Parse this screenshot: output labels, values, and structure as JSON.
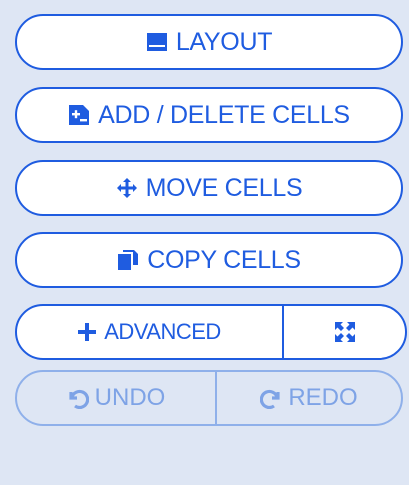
{
  "colors": {
    "background": "#dee6f4",
    "accent": "#1f5ce0",
    "disabled": "#7ea3e6",
    "button_bg": "#ffffff"
  },
  "buttons": {
    "layout": {
      "label": "LAYOUT",
      "icon": "window-icon"
    },
    "add_delete": {
      "label": "ADD / DELETE CELLS",
      "icon": "plus-square-icon"
    },
    "move": {
      "label": "MOVE CELLS",
      "icon": "move-arrows-icon"
    },
    "copy": {
      "label": "COPY CELLS",
      "icon": "copy-icon"
    }
  },
  "advanced_group": {
    "advanced": {
      "label": "ADVANCED",
      "icon": "plus-icon"
    },
    "expand": {
      "icon": "expand-icon"
    }
  },
  "history_group": {
    "undo": {
      "label": "UNDO",
      "icon": "undo-icon",
      "disabled": true
    },
    "redo": {
      "label": "REDO",
      "icon": "redo-icon",
      "disabled": true
    }
  }
}
